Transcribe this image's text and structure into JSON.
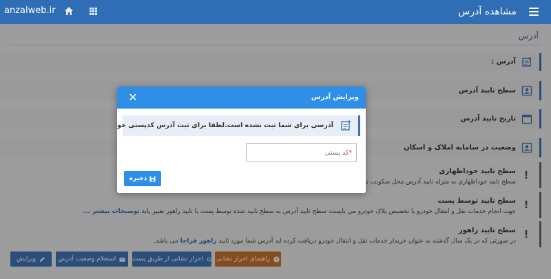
{
  "header": {
    "title": "مشاهده آدرس",
    "watermark": "anzalweb.ir"
  },
  "section": {
    "title": "آدرس"
  },
  "rows": [
    {
      "label": "آدرس :",
      "icon": "address-card-icon"
    },
    {
      "label": "سطح تایید آدرس",
      "icon": "user-icon"
    },
    {
      "label": "تاریخ تایید آدرس",
      "icon": "calendar-icon"
    },
    {
      "label": "وضعیت در سامانه املاک و اسکان",
      "icon": "user-icon"
    }
  ],
  "alerts": [
    {
      "title": "سطح تایید خوداظهاری",
      "desc": "سطح تایید خوداظهاری به منزله تایید آدرس محل سکونت تو"
    },
    {
      "title": "سطح تایید توسط پست",
      "desc": "جهت انجام خدمات نقل و انتقال خودرو یا تخصیص پلاک خودرو می بایست سطح تایید آدرس به سطح تایید شده توسط پست یا تایید راهور تغییر یابد.",
      "link": "توضیحات بیشتر ..."
    },
    {
      "title": "سطح تایید راهور",
      "desc": "در صورتی که در یک سال گذشته به عنوان خریدار خدمات نقل و انتقال خودرو دریافت کرده اید آدرس شما مورد تایید",
      "link": "راهور فراجا",
      "desc_end": "می باشد."
    }
  ],
  "buttons": {
    "edit": "ویرایش",
    "inquiry": "استعلام وضعیت آدرس",
    "post": "احراز نشانی از طریق پست",
    "guide": "راهنمای احراز نشانی"
  },
  "colors": {
    "primary": "#2f6db5",
    "modal_header": "#2e8ee8",
    "guide_button": "#c5712c"
  },
  "modal": {
    "title": "ویرایش آدرس",
    "close_icon": "close-icon",
    "info_text": "آدرسی برای شما ثبت نشده است.لطفا برای ثبت آدرس کدپستی خود را وارد نمایید",
    "postal_label": "کد پستی",
    "required_mark": "*",
    "save_label": "ذخیره"
  }
}
